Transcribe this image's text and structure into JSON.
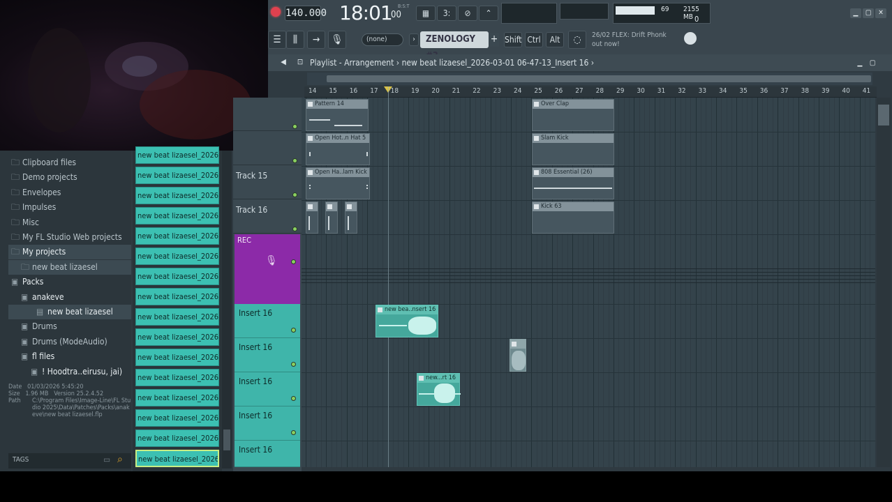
{
  "toolbar": {
    "tempo": "140.000",
    "time": "18:01",
    "time_small": "00",
    "time_tiny": "B:S:T",
    "cpu": "69",
    "memory": "2155 MB",
    "voices": "0",
    "pattern_select": "(none)",
    "plugin_select": "ZENOLOGY #3",
    "plus": "+",
    "keys": [
      "Shift",
      "Ctrl",
      "Alt"
    ],
    "news_line1": "26/02  FLEX: Drift Phonk",
    "news_line2": "out now!",
    "icons": [
      "typing-keyboard-icon",
      "count-in-icon",
      "wait-icon",
      "metronome-icon"
    ],
    "win_min": "▁",
    "win_max": "▢",
    "win_close": "✕"
  },
  "playlist": {
    "title_prefix": "Playlist - Arrangement",
    "title_sep": "›",
    "title_project": "new beat lizaesel_2026-03-01 06-47-13_Insert 16",
    "title_end": "›",
    "ruler": [
      "14",
      "15",
      "16",
      "17",
      "18",
      "19",
      "20",
      "21",
      "22",
      "23",
      "24",
      "25",
      "26",
      "27",
      "28",
      "29",
      "30",
      "31",
      "32",
      "33",
      "34",
      "35",
      "36",
      "37",
      "38",
      "39",
      "40",
      "41"
    ],
    "tracks": [
      {
        "name": ""
      },
      {
        "name": ""
      },
      {
        "name": "Track 15"
      },
      {
        "name": "Track 16"
      }
    ],
    "rec_track": "REC",
    "insert_tracks": [
      "Insert 16",
      "Insert 16",
      "Insert 16",
      "Insert 16",
      "Insert 16"
    ],
    "clips": [
      {
        "label": "Pattern 14"
      },
      {
        "label": "Open Hot..n Hat 5"
      },
      {
        "label": "Open Ha..lam Kick"
      },
      {
        "label": ""
      },
      {
        "label": ""
      },
      {
        "label": ""
      },
      {
        "label": "Over Clap"
      },
      {
        "label": "Slam Kick"
      },
      {
        "label": "808 Essential (26)"
      },
      {
        "label": "Kick 63"
      }
    ],
    "audio_clips": [
      {
        "label": "new bea..nsert 16"
      },
      {
        "label": "new...rt 16"
      },
      {
        "label": ""
      }
    ]
  },
  "browser": {
    "items": [
      {
        "label": "Clipboard files",
        "icon": "folder-icon"
      },
      {
        "label": "Demo projects",
        "icon": "folder-icon"
      },
      {
        "label": "Envelopes",
        "icon": "folder-icon"
      },
      {
        "label": "Impulses",
        "icon": "folder-icon"
      },
      {
        "label": "Misc",
        "icon": "folder-icon"
      },
      {
        "label": "My FL Studio Web projects",
        "icon": "folder-icon"
      },
      {
        "label": "My projects",
        "icon": "folder-icon"
      },
      {
        "label": "new beat lizaesel",
        "icon": "folder-icon"
      },
      {
        "label": "Packs",
        "icon": "pack-icon"
      },
      {
        "label": "anakeve",
        "icon": "pack-icon"
      },
      {
        "label": "new beat lizaesel",
        "icon": "file-icon"
      },
      {
        "label": "Drums",
        "icon": "pack-icon"
      },
      {
        "label": "Drums (ModeAudio)",
        "icon": "pack-icon"
      },
      {
        "label": "fl files",
        "icon": "pack-icon"
      },
      {
        "label": "! Hoodtra..eirusu, jai)",
        "icon": "pack-icon"
      }
    ],
    "info": {
      "date_label": "Date",
      "date": "01/03/2026 5:45:20",
      "size_label": "Size",
      "size": "1.96 MB",
      "version_label": "Version",
      "version": "25.2.4.52",
      "path_label": "Path",
      "path": "C:\\Program Files\\Image-Line\\FL Studio 2025\\Data\\Patches\\Packs\\anakeve\\new beat lizaesel.flp"
    },
    "tags_label": "TAGS"
  },
  "files": {
    "item_label": "new beat lizaesel_2026-",
    "count": 16
  }
}
